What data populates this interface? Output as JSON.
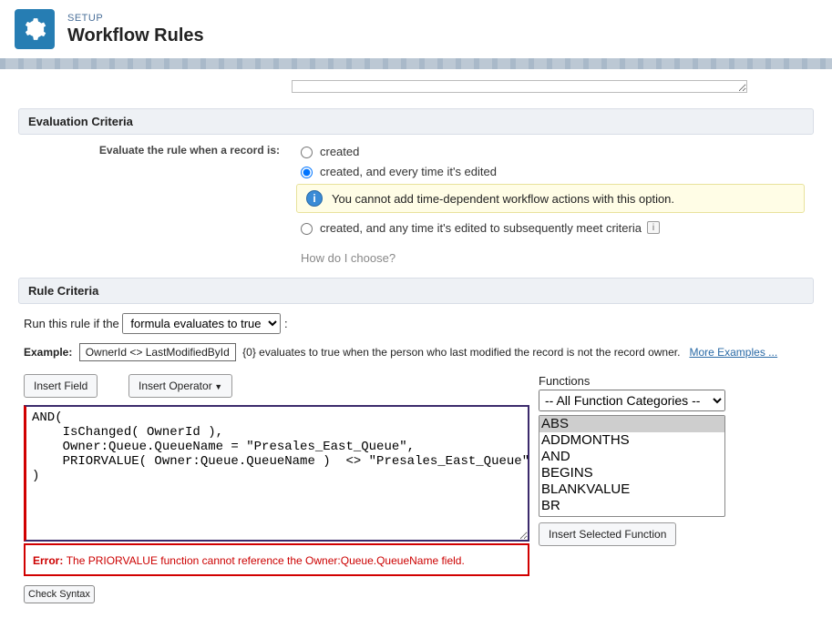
{
  "header": {
    "setup": "SETUP",
    "title": "Workflow Rules"
  },
  "sections": {
    "evaluation": "Evaluation Criteria",
    "ruleCriteria": "Rule Criteria"
  },
  "evaluation": {
    "label": "Evaluate the rule when a record is:",
    "opt_created": "created",
    "opt_created_edited": "created, and every time it's edited",
    "opt_created_meet": "created, and any time it's edited to subsequently meet criteria",
    "info": "You cannot add time-dependent workflow actions with this option.",
    "how": "How do I choose?"
  },
  "ruleCriteria": {
    "runLabelPre": "Run this rule if the",
    "selectOption": "formula evaluates to true",
    "colon": ":",
    "exampleLabel": "Example:",
    "exampleCode": "OwnerId <> LastModifiedById",
    "exampleText": "{0} evaluates to true when the person who last modified the record is not the record owner.",
    "moreExamples": "More Examples ..."
  },
  "buttons": {
    "insertField": "Insert Field",
    "insertOperator": "Insert Operator",
    "insertSelectedFunction": "Insert Selected Function",
    "checkSyntax": "Check Syntax"
  },
  "formula": "AND(\n    IsChanged( OwnerId ),\n    Owner:Queue.QueueName = \"Presales_East_Queue\",\n    PRIORVALUE( Owner:Queue.QueueName )  <> \"Presales_East_Queue\"\n)",
  "error": {
    "prefix": "Error:",
    "message": "The PRIORVALUE function cannot reference the Owner:Queue.QueueName field."
  },
  "functions": {
    "label": "Functions",
    "category": "-- All Function Categories --",
    "list": [
      "ABS",
      "ADDMONTHS",
      "AND",
      "BEGINS",
      "BLANKVALUE",
      "BR"
    ]
  }
}
